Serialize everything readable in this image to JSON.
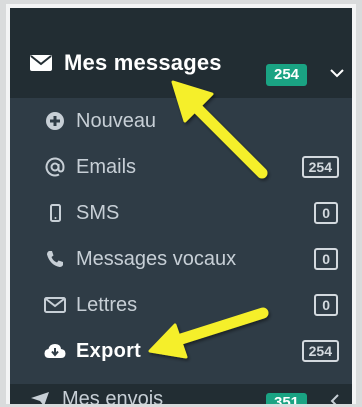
{
  "header": {
    "title": "Mes messages",
    "badge": "254",
    "icon": "envelope-icon",
    "accent": "#1aa383"
  },
  "menu": {
    "items": [
      {
        "label": "Nouveau",
        "icon": "plus-circle-icon",
        "count": ""
      },
      {
        "label": "Emails",
        "icon": "at-icon",
        "count": "254"
      },
      {
        "label": "SMS",
        "icon": "mobile-icon",
        "count": "0"
      },
      {
        "label": "Messages vocaux",
        "icon": "phone-icon",
        "count": "0"
      },
      {
        "label": "Lettres",
        "icon": "envelope-outline-icon",
        "count": "0"
      },
      {
        "label": "Export",
        "icon": "cloud-download-icon",
        "count": "254"
      }
    ]
  },
  "next_section": {
    "label": "Mes envois",
    "badge": "351"
  },
  "colors": {
    "sidebar_dark": "#222d33",
    "sidebar": "#2f3c46",
    "text": "#c7cfd6",
    "annotation": "#f5ef2a"
  }
}
